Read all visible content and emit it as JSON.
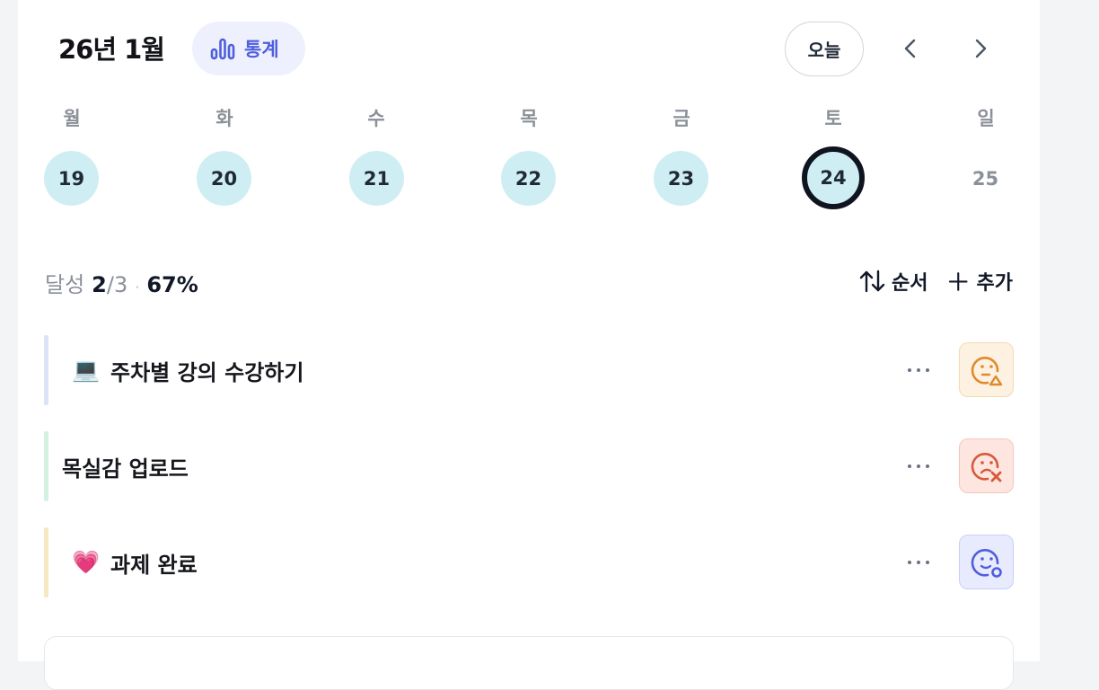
{
  "header": {
    "month_title": "26년 1월",
    "stats_label": "통계",
    "today_label": "오늘",
    "prev_icon": "chevron-left-icon",
    "next_icon": "chevron-right-icon",
    "accent_color": "#4f5fdc"
  },
  "week": {
    "days": [
      {
        "dow": "월",
        "date": "19"
      },
      {
        "dow": "화",
        "date": "20"
      },
      {
        "dow": "수",
        "date": "21"
      },
      {
        "dow": "목",
        "date": "22"
      },
      {
        "dow": "금",
        "date": "23"
      },
      {
        "dow": "토",
        "date": "24"
      },
      {
        "dow": "일",
        "date": "25"
      }
    ],
    "selected_date": "24",
    "done_color": "#cfeef3"
  },
  "summary": {
    "label": "달성",
    "done": "2",
    "total": "/3",
    "separator": "·",
    "percent": "67%",
    "sort_label": "순서",
    "add_label": "추가"
  },
  "tasks": [
    {
      "emoji": "💻",
      "title": "주차별 강의 수강하기",
      "bar_color": "#dde3f7",
      "mood": "face-triangle-icon",
      "mood_color": "#e08a2a",
      "mood_bg": "#fdf1e2"
    },
    {
      "emoji": "",
      "title": "목실감 업로드",
      "bar_color": "#d4f1e1",
      "mood": "face-x-icon",
      "mood_color": "#d9583b",
      "mood_bg": "#fde6e0"
    },
    {
      "emoji": "💗",
      "title": "과제 완료",
      "bar_color": "#f7e8c4",
      "mood": "face-circle-icon",
      "mood_color": "#4f5fdc",
      "mood_bg": "#e8ebfd"
    }
  ]
}
